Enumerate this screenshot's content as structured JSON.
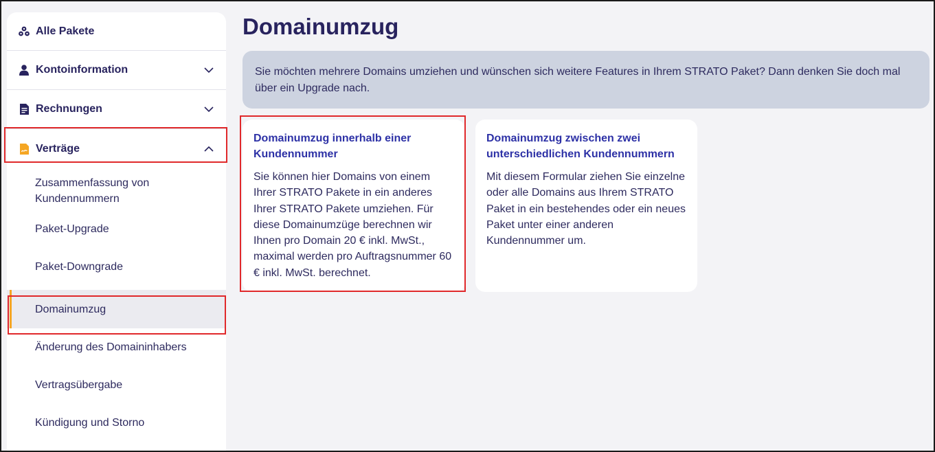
{
  "sidebar": {
    "all_packages": "Alle Pakete",
    "sections": [
      {
        "label": "Kontoinformation",
        "expanded": false
      },
      {
        "label": "Rechnungen",
        "expanded": false
      },
      {
        "label": "Verträge",
        "expanded": true
      }
    ],
    "sub_items": [
      {
        "label": "Zusammenfassung von Kundennummern",
        "active": false
      },
      {
        "label": "Paket-Upgrade",
        "active": false
      },
      {
        "label": "Paket-Downgrade",
        "active": false
      },
      {
        "label": "Domainumzug",
        "active": true
      },
      {
        "label": "Änderung des Domaininhabers",
        "active": false
      },
      {
        "label": "Vertragsübergabe",
        "active": false
      },
      {
        "label": "Kündigung und Storno",
        "active": false
      }
    ]
  },
  "main": {
    "title": "Domainumzug",
    "banner": "Sie möchten mehrere Domains umziehen und wünschen sich weitere Features in Ihrem STRATO Paket? Dann denken Sie doch mal über ein Upgrade nach.",
    "cards": [
      {
        "title": "Domainumzug innerhalb einer Kundennummer",
        "text": "Sie können hier Domains von einem Ihrer STRATO Pakete in ein anderes Ihrer STRATO Pakete umziehen. Für diese Domainumzüge berechnen wir Ihnen pro Domain 20 € inkl. MwSt., maximal werden pro Auftragsnummer 60 € inkl. MwSt. berechnet."
      },
      {
        "title": "Domainumzug zwischen zwei unterschiedlichen Kundennummern",
        "text": "Mit diesem Formular ziehen Sie einzelne oder alle Domains aus Ihrem STRATO Paket in ein bestehendes oder ein neues Paket unter einer anderen Kundennummer um."
      }
    ]
  },
  "colors": {
    "accent": "#f5a623",
    "highlight": "#e0282a",
    "title": "#28235e",
    "card_title": "#2d31a6",
    "banner_bg": "#cdd3e0"
  }
}
